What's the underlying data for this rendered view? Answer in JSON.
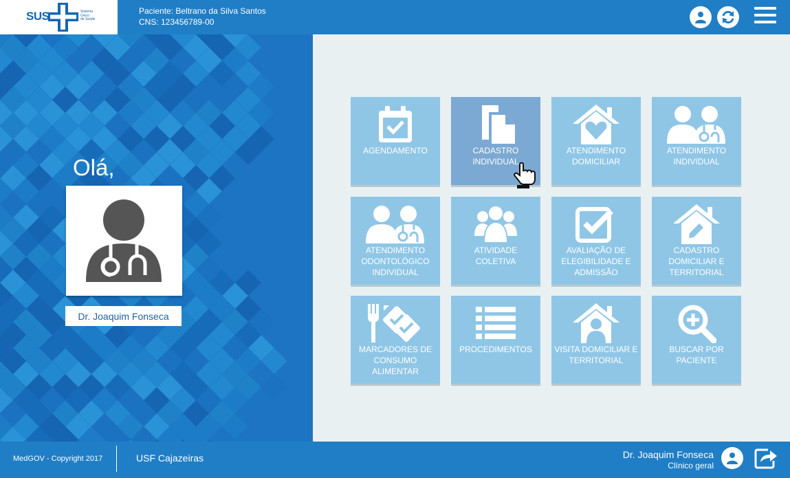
{
  "header": {
    "logo_text": "SUS",
    "logo_sub": [
      "Sistema",
      "Único",
      "de Saúde"
    ],
    "patient_line": "Paciente: Beltrano da Silva Santos",
    "cns_line": "CNS: 123456789-00"
  },
  "left": {
    "greeting": "Olá,",
    "doctor_name": "Dr. Joaquim Fonseca"
  },
  "tiles": [
    {
      "label": "AGENDAMENTO",
      "icon": "calendar-check-icon"
    },
    {
      "label": "CADASTRO INDIVIDUAL",
      "icon": "documents-icon",
      "active": true
    },
    {
      "label": "ATENDIMENTO DOMICILIAR",
      "icon": "house-heart-icon"
    },
    {
      "label": "ATENDIMENTO INDIVIDUAL",
      "icon": "doctor-patient-icon"
    },
    {
      "label": "ATENDIMENTO ODONTOLÓGICO INDIVIDUAL",
      "icon": "doctor-patient-icon"
    },
    {
      "label": "ATIVIDADE COLETIVA",
      "icon": "group-icon"
    },
    {
      "label": "AVALIAÇÃO DE ELEGIBILIDADE E ADMISSÃO",
      "icon": "checkbox-icon"
    },
    {
      "label": "CADASTRO DOMICILIAR E TERRITORIAL",
      "icon": "house-edit-icon"
    },
    {
      "label": "MARCADORES DE CONSUMO ALIMENTAR",
      "icon": "fork-checklist-icon"
    },
    {
      "label": "PROCEDIMENTOS",
      "icon": "list-icon"
    },
    {
      "label": "VISITA DOMICILIAR E TERRITORIAL",
      "icon": "house-doctor-icon"
    },
    {
      "label": "BUSCAR POR PACIENTE",
      "icon": "search-plus-icon"
    }
  ],
  "footer": {
    "copyright": "MedGOV - Copyright 2017",
    "unit": "USF Cajazeiras",
    "user_name": "Dr. Joaquim Fonseca",
    "user_role": "Clínico geral"
  },
  "colors": {
    "primary": "#1f7ec6",
    "tile": "#8fc6e6",
    "tile_active": "#7ba9d3",
    "background": "#e9f0f2"
  }
}
